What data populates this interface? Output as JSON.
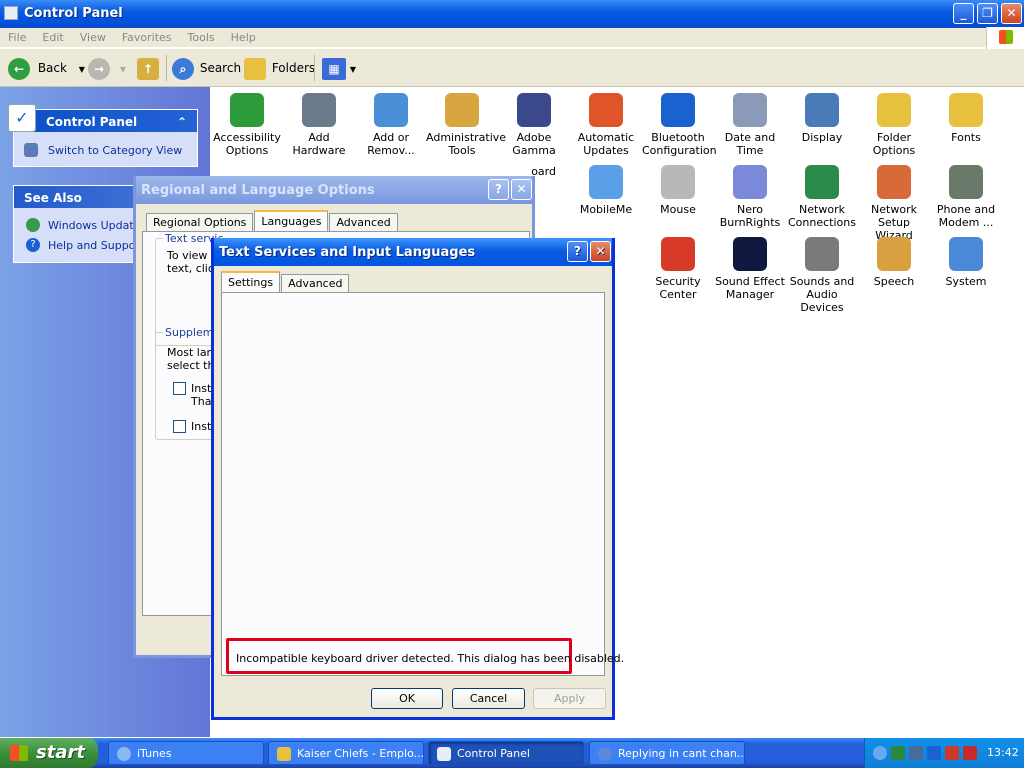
{
  "window": {
    "title": "Control Panel"
  },
  "menu": [
    "File",
    "Edit",
    "View",
    "Favorites",
    "Tools",
    "Help"
  ],
  "toolbar": {
    "back": "Back",
    "search": "Search",
    "folders": "Folders"
  },
  "left_pane": {
    "panel_title": "Control Panel",
    "switch_view": "Switch to Category View",
    "see_also_title": "See Also",
    "see_also": [
      "Windows Update",
      "Help and Support"
    ]
  },
  "icons": [
    {
      "label": "Accessibility Options",
      "icon": "accessibility-icon",
      "color": "#2e9b3a"
    },
    {
      "label": "Add Hardware",
      "icon": "add-hardware-icon",
      "color": "#6b7a8a"
    },
    {
      "label": "Add or Remov...",
      "icon": "add-remove-programs-icon",
      "color": "#4a8fd8"
    },
    {
      "label": "Administrative Tools",
      "icon": "administrative-tools-icon",
      "color": "#d8a640"
    },
    {
      "label": "Adobe Gamma",
      "icon": "adobe-gamma-icon",
      "color": "#3a4a8a"
    },
    {
      "label": "Automatic Updates",
      "icon": "automatic-updates-icon",
      "color": "#e0542a"
    },
    {
      "label": "Bluetooth Configuration",
      "icon": "bluetooth-icon",
      "color": "#1a62d0"
    },
    {
      "label": "Date and Time",
      "icon": "date-time-icon",
      "color": "#8a9ab8"
    },
    {
      "label": "Display",
      "icon": "display-icon",
      "color": "#4a7ab8"
    },
    {
      "label": "Folder Options",
      "icon": "folder-options-icon",
      "color": "#e8c040"
    },
    {
      "label": "Fonts",
      "icon": "fonts-icon",
      "color": "#e8c040"
    },
    {
      "label": "oard",
      "icon": "keyboard-icon",
      "color": "#8a90b8"
    },
    {
      "label": "MobileMe",
      "icon": "mobileme-icon",
      "color": "#5aa0e8"
    },
    {
      "label": "Mouse",
      "icon": "mouse-icon",
      "color": "#b8b8b8"
    },
    {
      "label": "Nero BurnRights",
      "icon": "nero-icon",
      "color": "#7a8ad8"
    },
    {
      "label": "Network Connections",
      "icon": "network-connections-icon",
      "color": "#2a8a4a"
    },
    {
      "label": "Network Setup Wizard",
      "icon": "network-setup-icon",
      "color": "#d86a3a"
    },
    {
      "label": "Phone and Modem ...",
      "icon": "phone-modem-icon",
      "color": "#6a7a6a"
    },
    {
      "label": "uled s",
      "icon": "scheduled-tasks-icon",
      "color": "#e8c040"
    },
    {
      "label": "Security Center",
      "icon": "security-center-icon",
      "color": "#d83a2a"
    },
    {
      "label": "Sound Effect Manager",
      "icon": "sound-effect-icon",
      "color": "#101840"
    },
    {
      "label": "Sounds and Audio Devices",
      "icon": "sounds-icon",
      "color": "#7a7a7a"
    },
    {
      "label": "Speech",
      "icon": "speech-icon",
      "color": "#d8a040"
    },
    {
      "label": "System",
      "icon": "system-icon",
      "color": "#4a8ad8"
    }
  ],
  "regional_dialog": {
    "title": "Regional and Language Options",
    "tabs": [
      "Regional Options",
      "Languages",
      "Advanced"
    ],
    "group1_title": "Text servic",
    "group1_text": [
      "To view o",
      "text, click"
    ],
    "group2_title": "Suppleme",
    "group2_text": [
      "Most langu",
      "select the"
    ],
    "check1": [
      "Instal",
      "Thai)"
    ],
    "check2": "Instal"
  },
  "text_services_dialog": {
    "title": "Text Services and Input Languages",
    "tabs": [
      "Settings",
      "Advanced"
    ],
    "message": "Incompatible keyboard driver detected.  This dialog has been disabled.",
    "ok": "OK",
    "cancel": "Cancel",
    "apply": "Apply"
  },
  "taskbar": {
    "start": "start",
    "tasks": [
      "iTunes",
      "Kaiser Chiefs - Emplo...",
      "Control Panel",
      "Replying in cant chan..."
    ],
    "clock": "13:42"
  },
  "colors": {
    "highlight_box": "#e0001a",
    "xp_blue": "#0054e3"
  }
}
